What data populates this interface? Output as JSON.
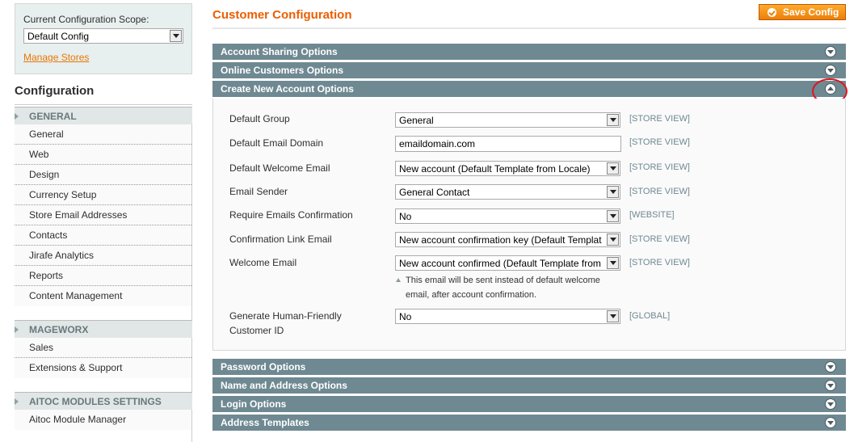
{
  "sidebar": {
    "scope_label": "Current Configuration Scope:",
    "scope_value": "Default Config",
    "manage_stores": "Manage Stores",
    "title": "Configuration",
    "groups": [
      {
        "title": "GENERAL",
        "items": [
          "General",
          "Web",
          "Design",
          "Currency Setup",
          "Store Email Addresses",
          "Contacts",
          "Jirafe Analytics",
          "Reports",
          "Content Management"
        ]
      },
      {
        "title": "MAGEWORX",
        "items": [
          "Sales",
          "Extensions & Support"
        ]
      },
      {
        "title": "AITOC MODULES SETTINGS",
        "items": [
          "Aitoc Module Manager"
        ]
      }
    ]
  },
  "main": {
    "title": "Customer Configuration",
    "save_label": "Save Config",
    "sections_top": [
      "Account Sharing Options",
      "Online Customers Options",
      "Create New Account Options"
    ],
    "sections_bottom": [
      "Password Options",
      "Name and Address Options",
      "Login Options",
      "Address Templates"
    ],
    "fields": [
      {
        "label": "Default Group",
        "value": "General",
        "scope": "[STORE VIEW]"
      },
      {
        "label": "Default Email Domain",
        "value": "emaildomain.com",
        "scope": "[STORE VIEW]"
      },
      {
        "label": "Default Welcome Email",
        "value": "New account (Default Template from Locale)",
        "scope": "[STORE VIEW]"
      },
      {
        "label": "Email Sender",
        "value": "General Contact",
        "scope": "[STORE VIEW]"
      },
      {
        "label": "Require Emails Confirmation",
        "value": "No",
        "scope": "[WEBSITE]"
      },
      {
        "label": "Confirmation Link Email",
        "value": "New account confirmation key (Default Templat",
        "scope": "[STORE VIEW]"
      },
      {
        "label": "Welcome Email",
        "value": "New account confirmed (Default Template from",
        "scope": "[STORE VIEW]"
      },
      {
        "label": "Generate Human-Friendly Customer ID",
        "value": "No",
        "scope": "[GLOBAL]"
      }
    ],
    "welcome_note": "This email will be sent instead of default welcome email, after account confirmation.",
    "icons": {
      "collapsed": "chevron-down-icon",
      "expanded": "chevron-up-icon",
      "save": "check-circle-icon"
    }
  }
}
